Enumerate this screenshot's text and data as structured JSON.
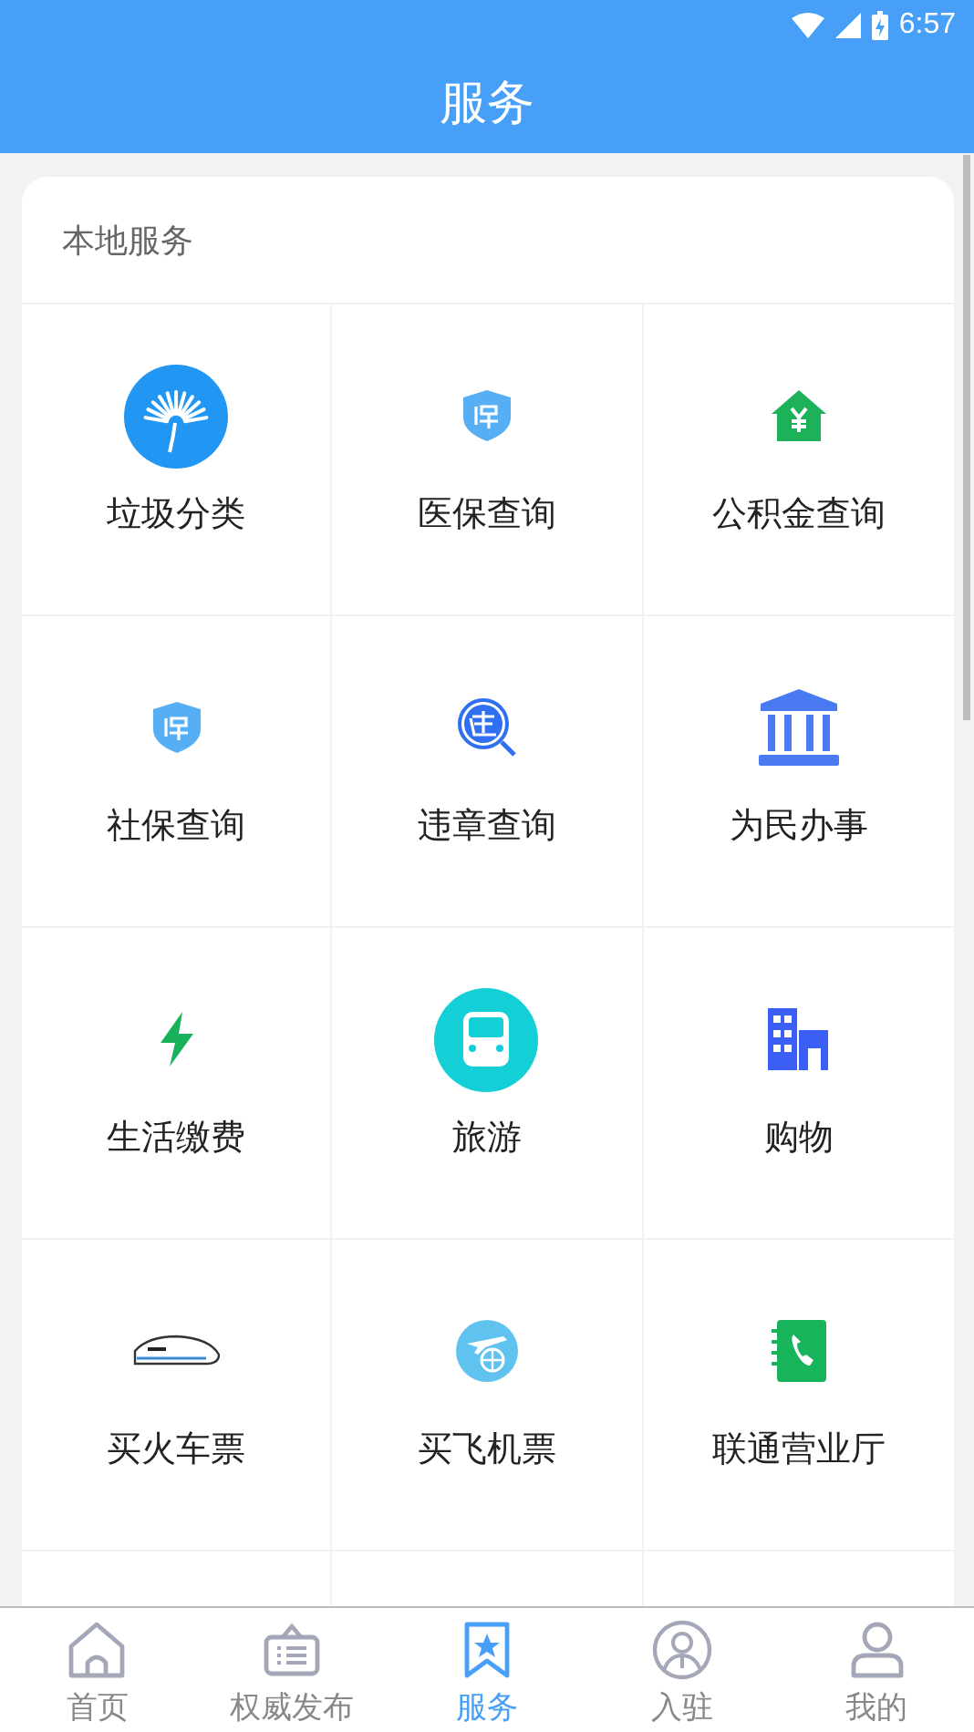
{
  "status_bar": {
    "time": "6:57"
  },
  "header": {
    "title": "服务"
  },
  "section": {
    "title": "本地服务",
    "services": [
      {
        "label": "垃圾分类",
        "kind": "fan"
      },
      {
        "label": "医保查询",
        "kind": "shield"
      },
      {
        "label": "公积金查询",
        "kind": "house"
      },
      {
        "label": "社保查询",
        "kind": "shield"
      },
      {
        "label": "违章查询",
        "kind": "magnifier"
      },
      {
        "label": "为民办事",
        "kind": "bank"
      },
      {
        "label": "生活缴费",
        "kind": "bolt"
      },
      {
        "label": "旅游",
        "kind": "bus"
      },
      {
        "label": "购物",
        "kind": "building"
      },
      {
        "label": "买火车票",
        "kind": "train"
      },
      {
        "label": "买飞机票",
        "kind": "plane"
      },
      {
        "label": "联通营业厅",
        "kind": "phonebook"
      }
    ]
  },
  "tabs": [
    {
      "label": "首页",
      "kind": "home",
      "selected": false
    },
    {
      "label": "权威发布",
      "kind": "board",
      "selected": false
    },
    {
      "label": "服务",
      "kind": "bookmark",
      "selected": true
    },
    {
      "label": "入驻",
      "kind": "agent",
      "selected": false
    },
    {
      "label": "我的",
      "kind": "user",
      "selected": false
    }
  ]
}
